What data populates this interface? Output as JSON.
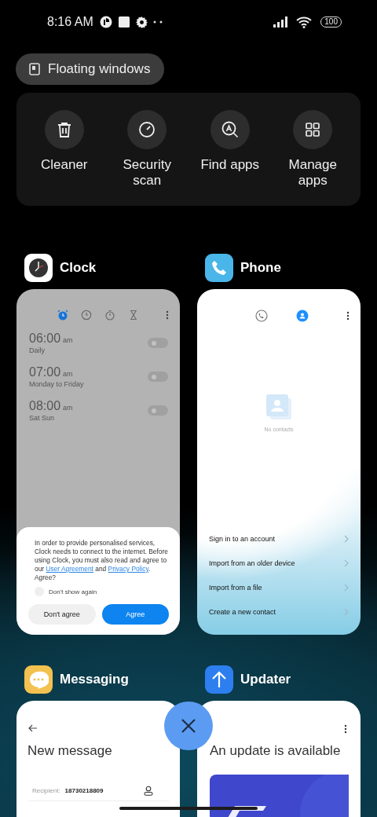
{
  "status_bar": {
    "time": "8:16 AM",
    "battery": "100"
  },
  "floating_windows": {
    "label": "Floating windows"
  },
  "quick_actions": [
    {
      "kind": "cleaner",
      "label": "Cleaner"
    },
    {
      "kind": "security",
      "label": "Security scan"
    },
    {
      "kind": "find",
      "label": "Find apps"
    },
    {
      "kind": "manage",
      "label": "Manage apps"
    }
  ],
  "recent_apps": [
    {
      "kind": "clock",
      "name": "Clock",
      "tabs": [
        {
          "kind": "alarm",
          "selected": true
        },
        {
          "kind": "clock",
          "selected": false
        },
        {
          "kind": "stopwatch",
          "selected": false
        },
        {
          "kind": "timer",
          "selected": false
        }
      ],
      "alarms": [
        {
          "time": "06:00",
          "period": "am",
          "repeat": "Daily",
          "on": false
        },
        {
          "time": "07:00",
          "period": "am",
          "repeat": "Monday to Friday",
          "on": false
        },
        {
          "time": "08:00",
          "period": "am",
          "repeat": "Sat Sun",
          "on": false
        }
      ],
      "dialog": {
        "segments": [
          {
            "kind": "text",
            "text": "In order to provide personalised services, Clock needs to connect to the internet. Before using Clock, you must also read and agree to our"
          },
          {
            "kind": "link",
            "text": "User Agreement"
          },
          {
            "kind": "text",
            "text": "and"
          },
          {
            "kind": "link",
            "text": "Privacy Policy"
          },
          {
            "kind": "text",
            "text": ". Agree?"
          }
        ],
        "checkbox": {
          "label": "Don't show again",
          "checked": false
        },
        "buttons": [
          {
            "label": "Don't agree",
            "kind": "secondary"
          },
          {
            "label": "Agree",
            "kind": "primary"
          }
        ]
      }
    },
    {
      "kind": "phone",
      "name": "Phone",
      "tabs": [
        {
          "kind": "calls",
          "selected": false
        },
        {
          "kind": "contacts",
          "selected": true
        }
      ],
      "empty_text": "No contacts",
      "options": [
        "Sign in to an account",
        "Import from an older device",
        "Import from a file",
        "Create a new contact"
      ]
    },
    {
      "kind": "messaging",
      "name": "Messaging",
      "title": "New message",
      "recipient_label": "Recipient:",
      "recipient": "18730218809"
    },
    {
      "kind": "updater",
      "name": "Updater",
      "title": "An update is available"
    }
  ]
}
